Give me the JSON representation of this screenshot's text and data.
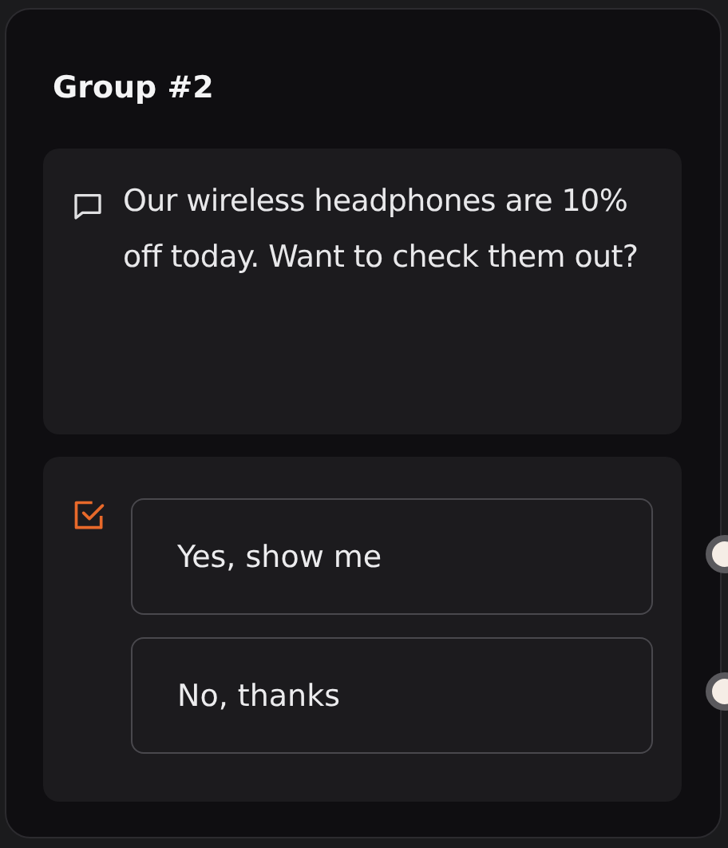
{
  "node": {
    "title": "Group #2",
    "message": {
      "text": "Our wireless headphones are 10% off today. Want to check them out?"
    },
    "choices": [
      {
        "label": "Yes, show me"
      },
      {
        "label": "No, thanks"
      }
    ]
  }
}
